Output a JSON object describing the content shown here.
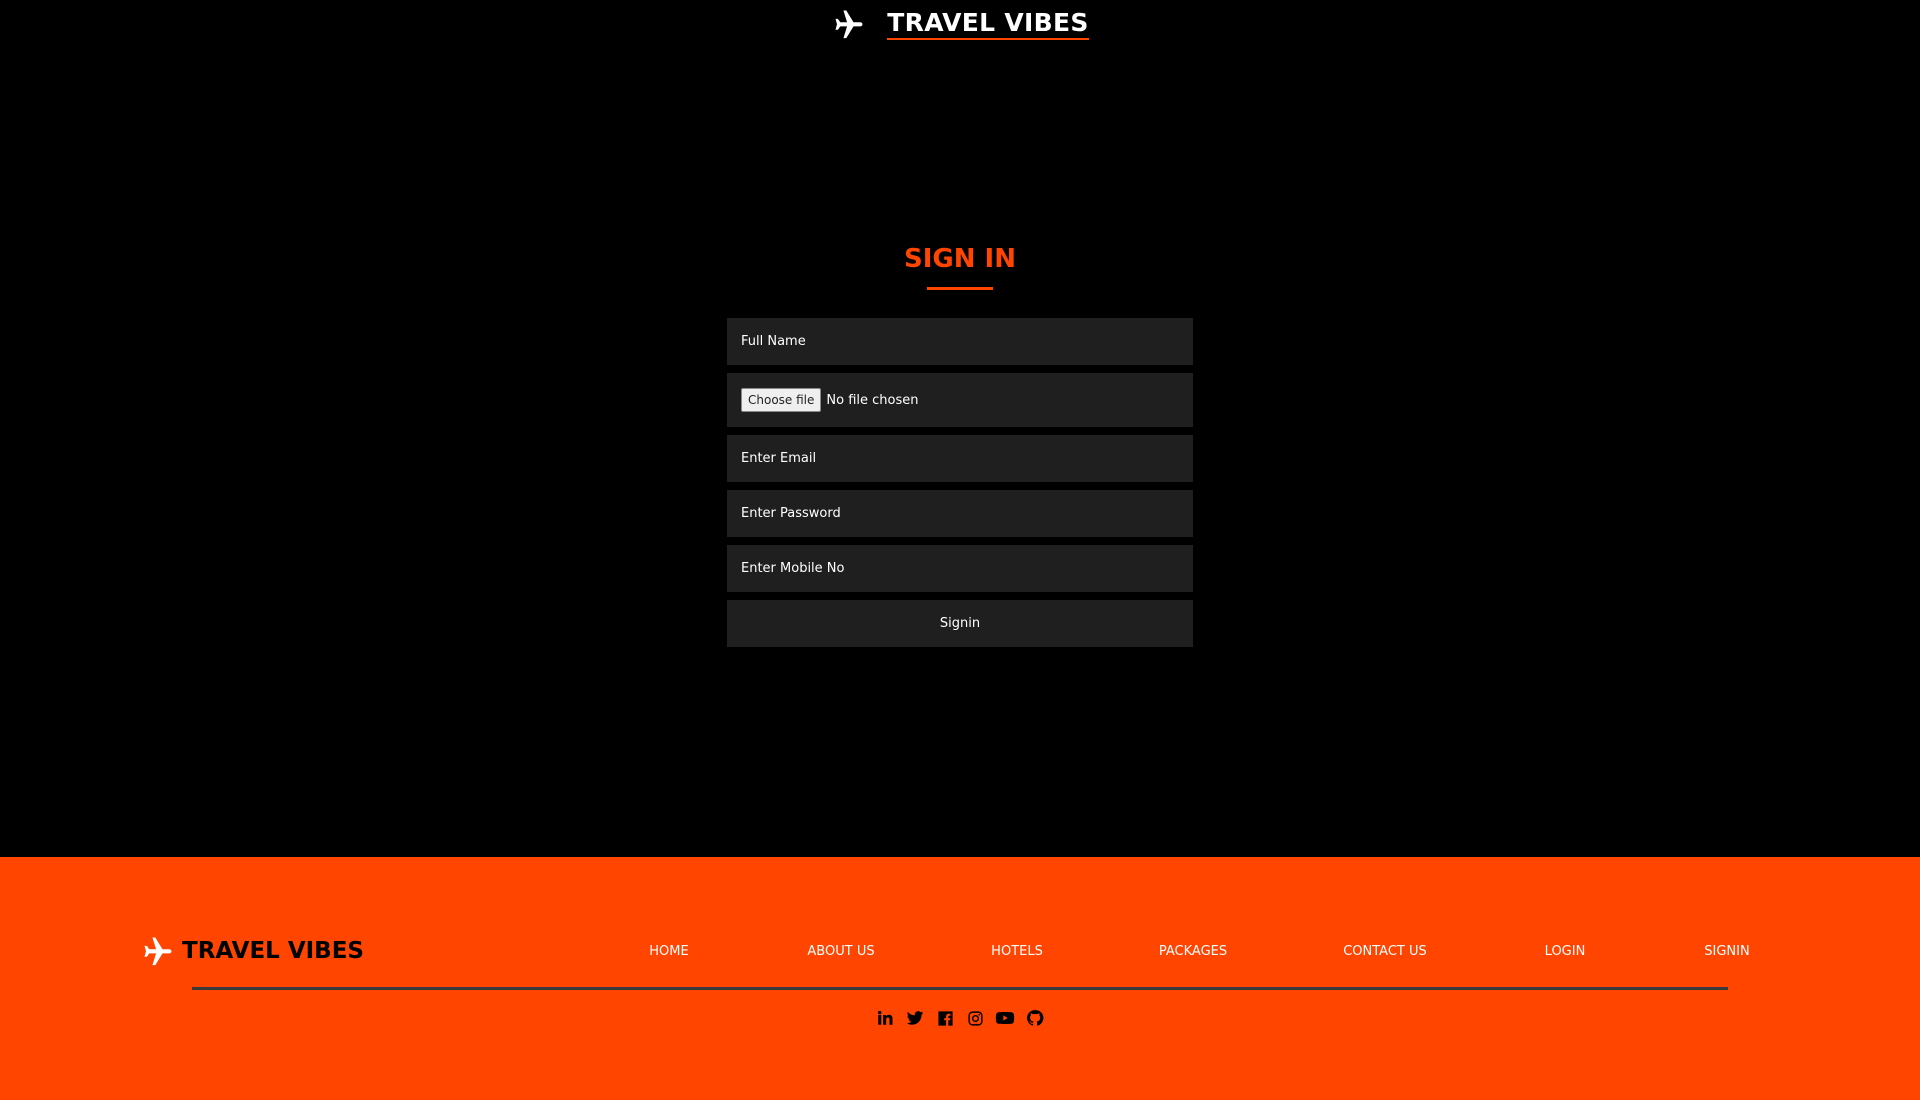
{
  "header": {
    "brand_name": "TRAVEL VIBES"
  },
  "main": {
    "title": "SIGN IN",
    "form": {
      "full_name_placeholder": "Full Name",
      "file_button_label": "Choose file",
      "file_status": "No file chosen",
      "email_placeholder": "Enter Email",
      "password_placeholder": "Enter Password",
      "mobile_placeholder": "Enter Mobile No",
      "submit_label": "Signin"
    }
  },
  "footer": {
    "brand_name": "TRAVEL VIBES",
    "nav": [
      "HOME",
      "ABOUT US",
      "HOTELS",
      "PACKAGES",
      "CONTACT US",
      "LOGIN",
      "SIGNIN"
    ],
    "social_icons": [
      "linkedin-icon",
      "twitter-icon",
      "facebook-icon",
      "instagram-icon",
      "youtube-icon",
      "github-icon"
    ]
  },
  "colors": {
    "accent": "#ff4500",
    "background": "#000000",
    "field_background": "#1f1f1f"
  }
}
